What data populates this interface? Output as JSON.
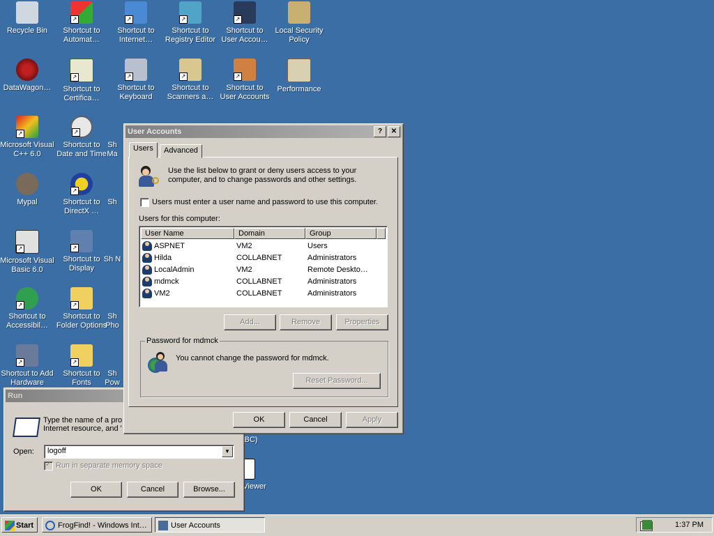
{
  "desktop": {
    "icons": [
      {
        "label": "Recycle Bin",
        "icon": "recycle-bin-icon"
      },
      {
        "label": "Shortcut to Automat…",
        "icon": "windows-flag-icon"
      },
      {
        "label": "Shortcut to Internet…",
        "icon": "internet-options-icon"
      },
      {
        "label": "Shortcut to Registry Editor",
        "icon": "registry-editor-icon"
      },
      {
        "label": "Shortcut to User Accou…",
        "icon": "user-accounts-icon"
      },
      {
        "label": "Local Security Policy",
        "icon": "security-policy-icon"
      },
      {
        "label": "DataWagon…",
        "icon": "datawagon-icon"
      },
      {
        "label": "Shortcut to Certifica…",
        "icon": "certificate-icon"
      },
      {
        "label": "Shortcut to Keyboard",
        "icon": "keyboard-icon"
      },
      {
        "label": "Shortcut to Scanners a…",
        "icon": "scanner-icon"
      },
      {
        "label": "Shortcut to User Accounts",
        "icon": "user-accounts-icon"
      },
      {
        "label": "Performance",
        "icon": "performance-icon"
      },
      {
        "label": "Microsoft Visual C++ 6.0",
        "icon": "visual-cpp-icon"
      },
      {
        "label": "Shortcut to Date and Time",
        "icon": "clock-icon"
      },
      {
        "label": "Sh Ma",
        "icon": "shortcut-icon"
      },
      {
        "label": "Mypal",
        "icon": "mypal-icon"
      },
      {
        "label": "Shortcut to DirectX …",
        "icon": "directx-icon"
      },
      {
        "label": "Sh",
        "icon": "shortcut-icon"
      },
      {
        "label": "Microsoft Visual Basic 6.0",
        "icon": "visual-basic-icon"
      },
      {
        "label": "Shortcut to Display",
        "icon": "display-icon"
      },
      {
        "label": "Sh N",
        "icon": "shortcut-icon"
      },
      {
        "label": "Shortcut to Accessibil…",
        "icon": "accessibility-icon"
      },
      {
        "label": "Shortcut to Folder Options",
        "icon": "folder-options-icon"
      },
      {
        "label": "Sh Pho",
        "icon": "shortcut-icon"
      },
      {
        "label": "Shortcut to Add Hardware",
        "icon": "add-hardware-icon"
      },
      {
        "label": "Shortcut to Fonts",
        "icon": "fonts-folder-icon"
      },
      {
        "label": "Sh Pow",
        "icon": "shortcut-icon"
      },
      {
        "label": "BC)",
        "icon": "shortcut-icon"
      },
      {
        "label": "Viewer",
        "icon": "viewer-icon"
      }
    ]
  },
  "user_accounts": {
    "title": "User Accounts",
    "help": "?",
    "close": "✕",
    "tabs": [
      "Users",
      "Advanced"
    ],
    "intro": "Use the list below to grant or deny users access to your computer, and to change passwords and other settings.",
    "checkbox_label": "Users must enter a user name and password to use this computer.",
    "list_label": "Users for this computer:",
    "columns": [
      "User Name",
      "Domain",
      "Group"
    ],
    "rows": [
      {
        "name": "ASPNET",
        "domain": "VM2",
        "group": "Users"
      },
      {
        "name": "Hilda",
        "domain": "COLLABNET",
        "group": "Administrators"
      },
      {
        "name": "LocalAdmin",
        "domain": "VM2",
        "group": "Remote Deskto…"
      },
      {
        "name": "mdmck",
        "domain": "COLLABNET",
        "group": "Administrators"
      },
      {
        "name": "VM2",
        "domain": "COLLABNET",
        "group": "Administrators"
      }
    ],
    "add_btn": "Add...",
    "remove_btn": "Remove",
    "properties_btn": "Properties",
    "password_group": "Password for mdmck",
    "password_text": "You cannot change the password for mdmck.",
    "reset_btn": "Reset Password...",
    "ok_btn": "OK",
    "cancel_btn": "Cancel",
    "apply_btn": "Apply"
  },
  "run": {
    "title": "Run",
    "desc_line1": "Type the name of a pro",
    "desc_line2": "Internet resource, and '",
    "open_label": "Open:",
    "open_value": "logoff",
    "checkbox_label": "Run in separate memory space",
    "ok_btn": "OK",
    "cancel_btn": "Cancel",
    "browse_btn": "Browse..."
  },
  "taskbar": {
    "start": "Start",
    "items": [
      "FrogFind! - Windows Int…",
      "User Accounts"
    ],
    "time": "1:37 PM"
  }
}
